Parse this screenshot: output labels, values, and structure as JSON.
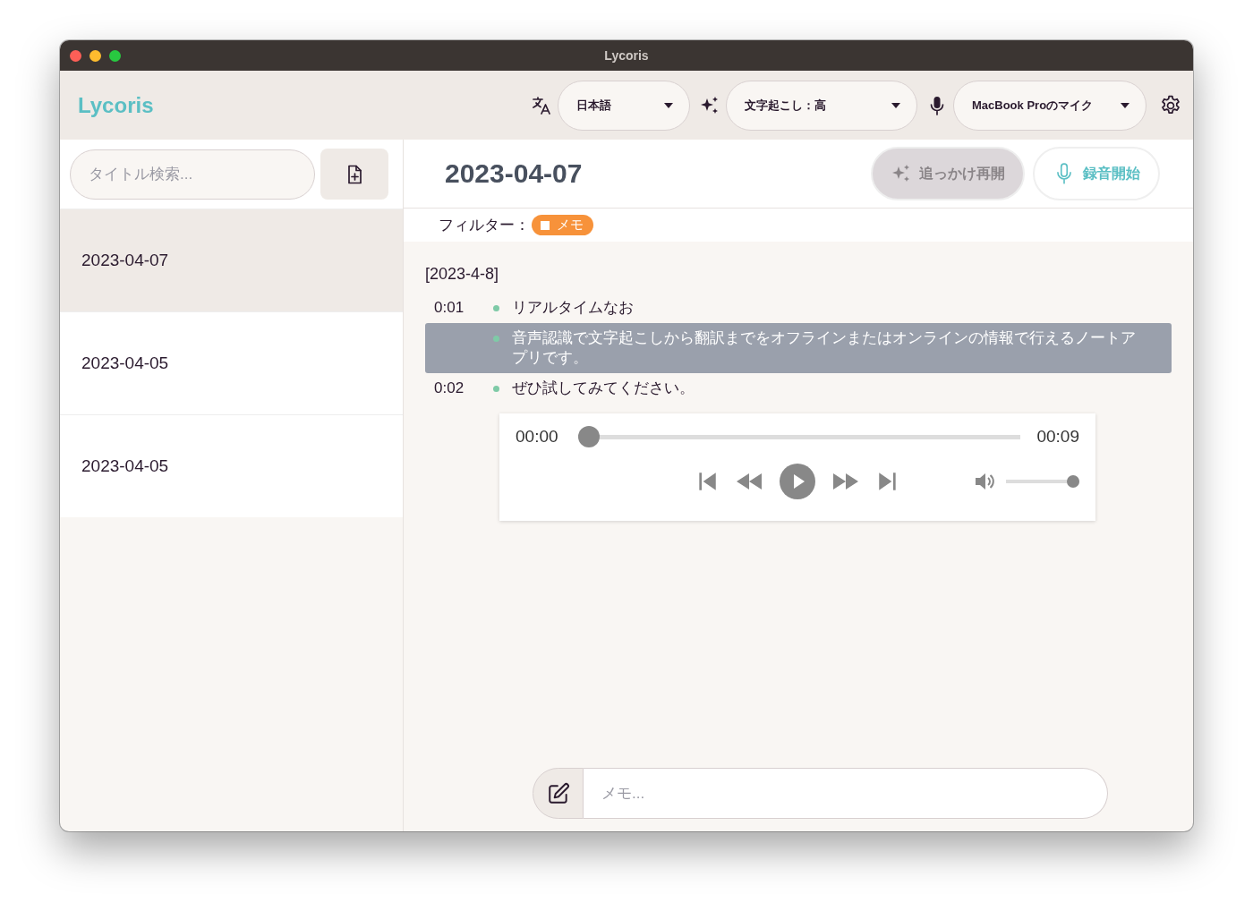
{
  "window": {
    "title": "Lycoris"
  },
  "header": {
    "logo": "Lycoris",
    "language": {
      "value": "日本語"
    },
    "quality": {
      "value": "文字起こし：高"
    },
    "microphone": {
      "value": "MacBook Proのマイク"
    }
  },
  "sidebar": {
    "search": {
      "placeholder": "タイトル検索..."
    },
    "items": [
      {
        "title": "2023-04-07",
        "selected": true
      },
      {
        "title": "2023-04-05",
        "selected": false
      },
      {
        "title": "2023-04-05",
        "selected": false
      }
    ]
  },
  "note": {
    "title": "2023-04-07",
    "resume_button": {
      "label": "追っかけ再開",
      "disabled": true
    },
    "record_button": {
      "label": "録音開始"
    },
    "filter": {
      "label": "フィルター：",
      "tags": [
        {
          "label": "メモ",
          "color": "#f7923a"
        }
      ]
    },
    "date": "[2023-4-8]",
    "segments": [
      {
        "time": "0:01",
        "sentences": [
          {
            "text": "リアルタイムなお",
            "selected": false
          },
          {
            "text": "音声認識で文字起こしから翻訳までをオフラインまたはオンラインの情報で行えるノートアプリです。",
            "selected": true
          }
        ]
      },
      {
        "time": "0:02",
        "sentences": [
          {
            "text": "ぜひ試してみてください。",
            "selected": false
          }
        ]
      }
    ],
    "player": {
      "current": "00:00",
      "duration": "00:09",
      "level": 0,
      "volume": {
        "level": 1
      }
    },
    "memo": {
      "placeholder": "メモ..."
    }
  }
}
